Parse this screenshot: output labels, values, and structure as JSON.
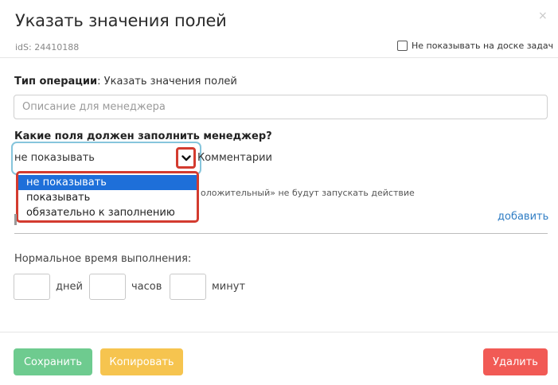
{
  "dialog": {
    "title": "Указать значения полей",
    "close_glyph": "×",
    "ids_label": "idS: 24410188",
    "hide_checkbox": {
      "label": "Не показывать на доске задач",
      "checked": false
    }
  },
  "operation": {
    "type_label": "Тип операции",
    "type_value": ": Указать значения полей",
    "description_placeholder": "Описание для менеджера",
    "description_value": ""
  },
  "fields": {
    "question": "Какие поля должен заполнить менеджер?",
    "select_current": "не показывать",
    "field_name": "Комментарии",
    "options": [
      "не показывать",
      "показывать",
      "обязательно к заполнению"
    ],
    "selected_index": 0,
    "hint": "оложительный» не будут запускать действие",
    "add_link": "добавить"
  },
  "time": {
    "label": "Нормальное время выполнения:",
    "days_label": "дней",
    "hours_label": "часов",
    "minutes_label": "минут",
    "days_value": "",
    "hours_value": "",
    "minutes_value": ""
  },
  "footer": {
    "save_label": "Сохранить",
    "copy_label": "Копировать",
    "delete_label": "Удалить"
  },
  "colors": {
    "save": "#6ecb8f",
    "copy": "#f6c44f",
    "delete": "#f15a55",
    "link": "#2f7dc4",
    "highlight": "#d33b2f",
    "selected_option": "#1e6fd9"
  },
  "icons": {
    "close": "close-icon",
    "dropdown_arrow": "chevron-down-icon"
  }
}
